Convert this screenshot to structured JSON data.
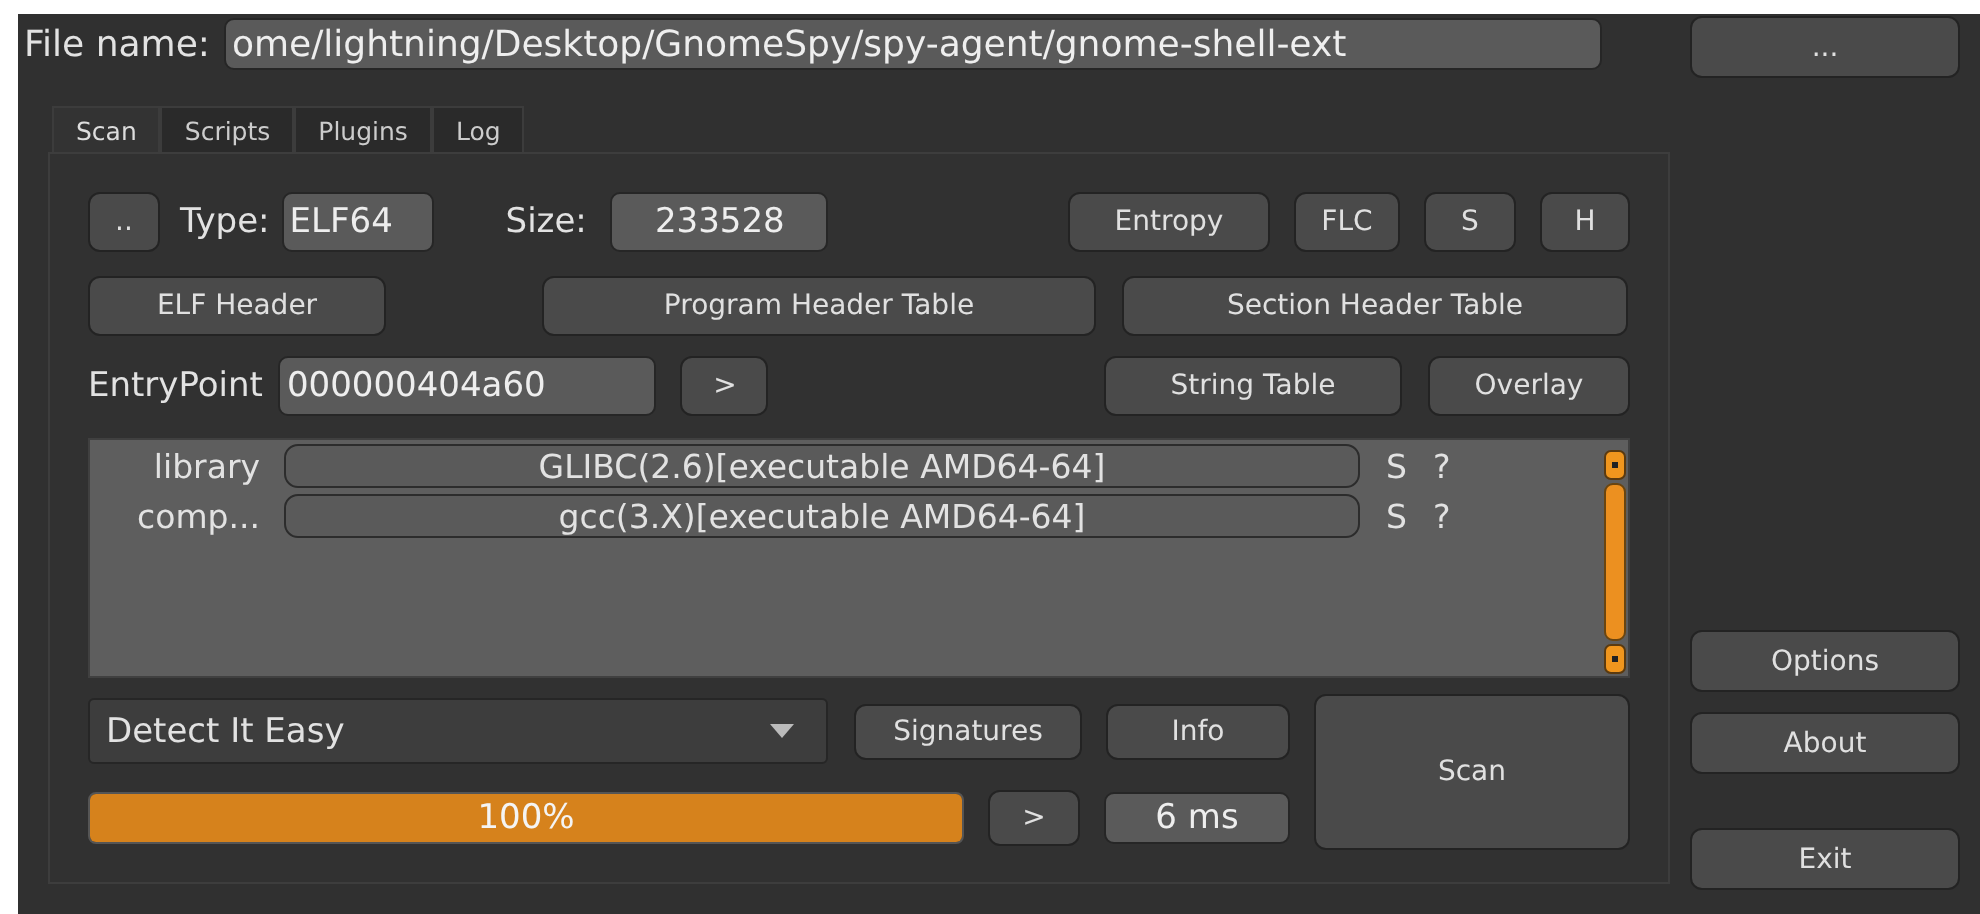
{
  "file": {
    "label": "File name:",
    "value": "ome/lightning/Desktop/GnomeSpy/spy-agent/gnome-shell-ext",
    "browse": "..."
  },
  "tabs": [
    {
      "label": "Scan",
      "selected": true
    },
    {
      "label": "Scripts",
      "selected": false
    },
    {
      "label": "Plugins",
      "selected": false
    },
    {
      "label": "Log",
      "selected": false
    }
  ],
  "info": {
    "back": "..",
    "type_label": "Type:",
    "type_value": "ELF64",
    "size_label": "Size:",
    "size_value": "233528",
    "tools": [
      "Entropy",
      "FLC",
      "S",
      "H"
    ],
    "headers": [
      "ELF Header",
      "Program Header Table",
      "Section Header Table"
    ],
    "entry_label": "EntryPoint",
    "entry_value": "000000404a60",
    "entry_go": ">",
    "tables": [
      "String Table",
      "Overlay"
    ]
  },
  "results": [
    {
      "type": "library",
      "name": "GLIBC(2.6)[executable AMD64-64]",
      "s": "S",
      "help": "?"
    },
    {
      "type": "comp...",
      "name": "gcc(3.X)[executable AMD64-64]",
      "s": "S",
      "help": "?"
    }
  ],
  "scan": {
    "engine": "Detect It Easy",
    "signatures": "Signatures",
    "info": "Info",
    "progress": {
      "level": 1,
      "text": "100%"
    },
    "more": ">",
    "time": "6 ms",
    "scan": "Scan"
  },
  "side": [
    "Options",
    "About",
    "Exit"
  ]
}
